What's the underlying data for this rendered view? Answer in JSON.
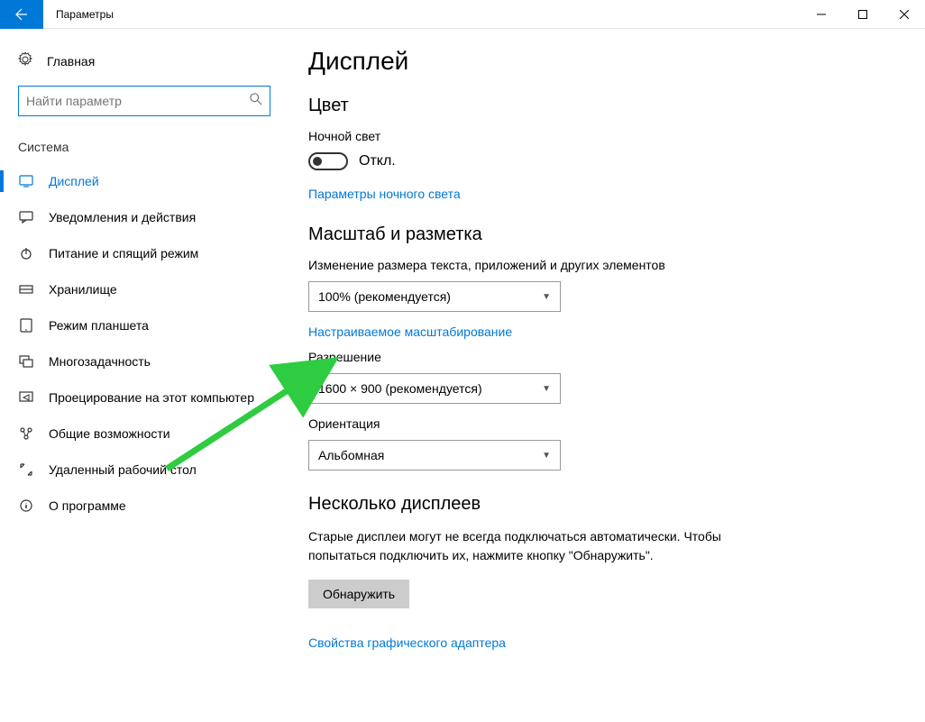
{
  "window": {
    "title": "Параметры"
  },
  "sidebar": {
    "home": "Главная",
    "search_placeholder": "Найти параметр",
    "section": "Система",
    "items": [
      {
        "label": "Дисплей"
      },
      {
        "label": "Уведомления и действия"
      },
      {
        "label": "Питание и спящий режим"
      },
      {
        "label": "Хранилище"
      },
      {
        "label": "Режим планшета"
      },
      {
        "label": "Многозадачность"
      },
      {
        "label": "Проецирование на этот компьютер"
      },
      {
        "label": "Общие возможности"
      },
      {
        "label": "Удаленный рабочий стол"
      },
      {
        "label": "О программе"
      }
    ]
  },
  "main": {
    "title": "Дисплей",
    "sections": {
      "color": {
        "heading": "Цвет",
        "night_light_label": "Ночной свет",
        "toggle_state": "Откл.",
        "night_light_link": "Параметры ночного света"
      },
      "scale": {
        "heading": "Масштаб и разметка",
        "scale_label": "Изменение размера текста, приложений и других элементов",
        "scale_value": "100% (рекомендуется)",
        "custom_scale_link": "Настраиваемое масштабирование",
        "resolution_label": "Разрешение",
        "resolution_value": "1600 × 900 (рекомендуется)",
        "orientation_label": "Ориентация",
        "orientation_value": "Альбомная"
      },
      "multi": {
        "heading": "Несколько дисплеев",
        "body": "Старые дисплеи могут не всегда подключаться автоматически. Чтобы попытаться подключить их, нажмите кнопку \"Обнаружить\".",
        "detect_button": "Обнаружить",
        "adapter_link": "Свойства графического адаптера"
      }
    }
  }
}
